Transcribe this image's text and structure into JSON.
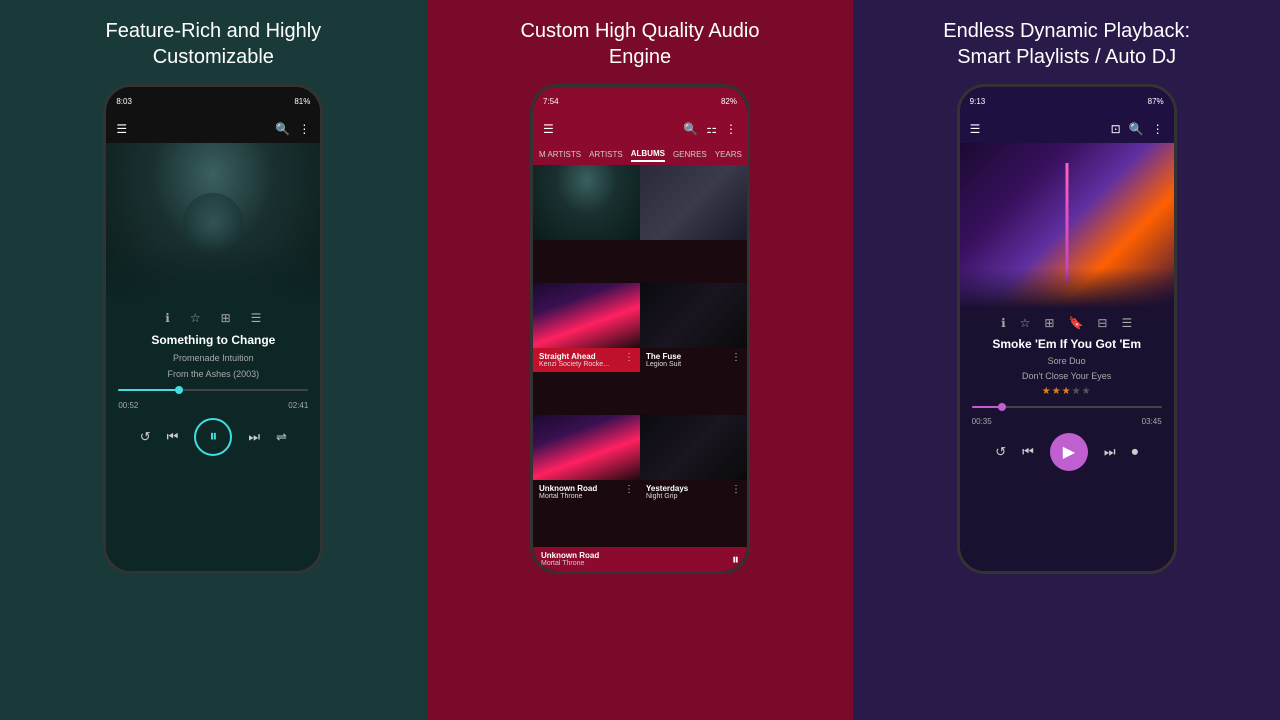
{
  "panel1": {
    "title": "Feature-Rich and Highly Customizable",
    "statusBar": {
      "time": "8:03",
      "battery": "81%"
    },
    "tabs": [],
    "song": {
      "title": "Something to Change",
      "artist": "Promenade Intuition",
      "album": "From the Ashes (2003)",
      "currentTime": "00:52",
      "totalTime": "02:41",
      "progress": 32
    },
    "actions": [
      "ℹ",
      "★",
      "⊞",
      "☰"
    ]
  },
  "panel2": {
    "title": "Custom High Quality Audio Engine",
    "statusBar": {
      "time": "7:54",
      "battery": "82%"
    },
    "tabs": [
      "M ARTISTS",
      "ARTISTS",
      "ALBUMS",
      "GENRES",
      "YEARS"
    ],
    "activeTab": "ALBUMS",
    "albums": [
      {
        "name": "",
        "artist": "",
        "bg": "art-parking"
      },
      {
        "name": "",
        "artist": "",
        "bg": "art-building"
      },
      {
        "name": "Straight Ahead",
        "artist": "Kenzi Society Rocke...",
        "bg": "art-neon-city",
        "active": true
      },
      {
        "name": "The Fuse",
        "artist": "Legion Suit",
        "bg": "art-dark-corridor"
      },
      {
        "name": "Unknown Road",
        "artist": "Mortal Throne",
        "bg": "art-neon-city"
      },
      {
        "name": "Yesterdays",
        "artist": "Night Grip",
        "bg": "art-dark-corridor"
      }
    ],
    "nowPlaying": {
      "title": "Unknown Road",
      "artist": "Mortal Throne"
    }
  },
  "panel3": {
    "title": "Endless Dynamic Playback: Smart Playlists / Auto DJ",
    "statusBar": {
      "time": "9:13",
      "battery": "87%"
    },
    "song": {
      "title": "Smoke 'Em If You Got 'Em",
      "artist": "Sore Duo",
      "album": "Don't Close Your Eyes",
      "currentTime": "00:35",
      "totalTime": "03:45",
      "progress": 16,
      "rating": 3
    },
    "actions": [
      "ℹ",
      "★",
      "⊞",
      "🔖",
      "⊟",
      "☰"
    ]
  },
  "icons": {
    "menu": "☰",
    "search": "🔍",
    "more": "⋮",
    "filter": "⚏",
    "cast": "⊡",
    "prev": "⏮",
    "next": "⏭",
    "pause": "⏸",
    "play": "▶",
    "shuffle": "⇌",
    "repeat": "↺"
  }
}
